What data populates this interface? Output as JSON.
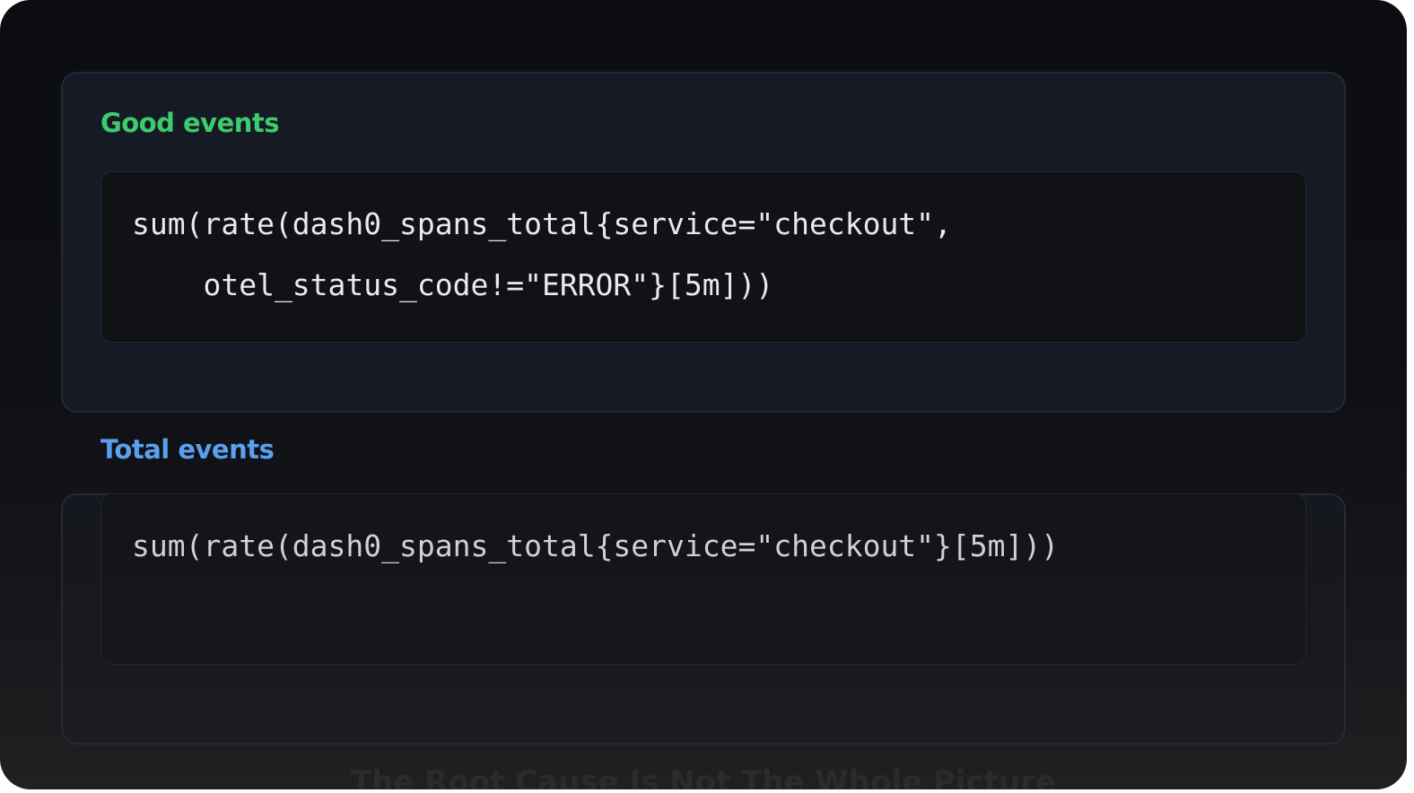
{
  "good_events": {
    "title": "Good events",
    "query_lines": [
      "sum(rate(dash0_spans_total{service=\"checkout\",",
      "    otel_status_code!=\"ERROR\"}[5m]))"
    ]
  },
  "total_events": {
    "title": "Total events",
    "query_lines": [
      "sum(rate(dash0_spans_total{service=\"checkout\"}[5m]))"
    ]
  },
  "footer": {
    "faded_text": "The Root Cause Is Not The Whole Picture"
  },
  "colors": {
    "good_title": "#3ccc6e",
    "total_title": "#5aa0ef",
    "background": "#0e0f14",
    "code_text": "#e8eaee"
  }
}
